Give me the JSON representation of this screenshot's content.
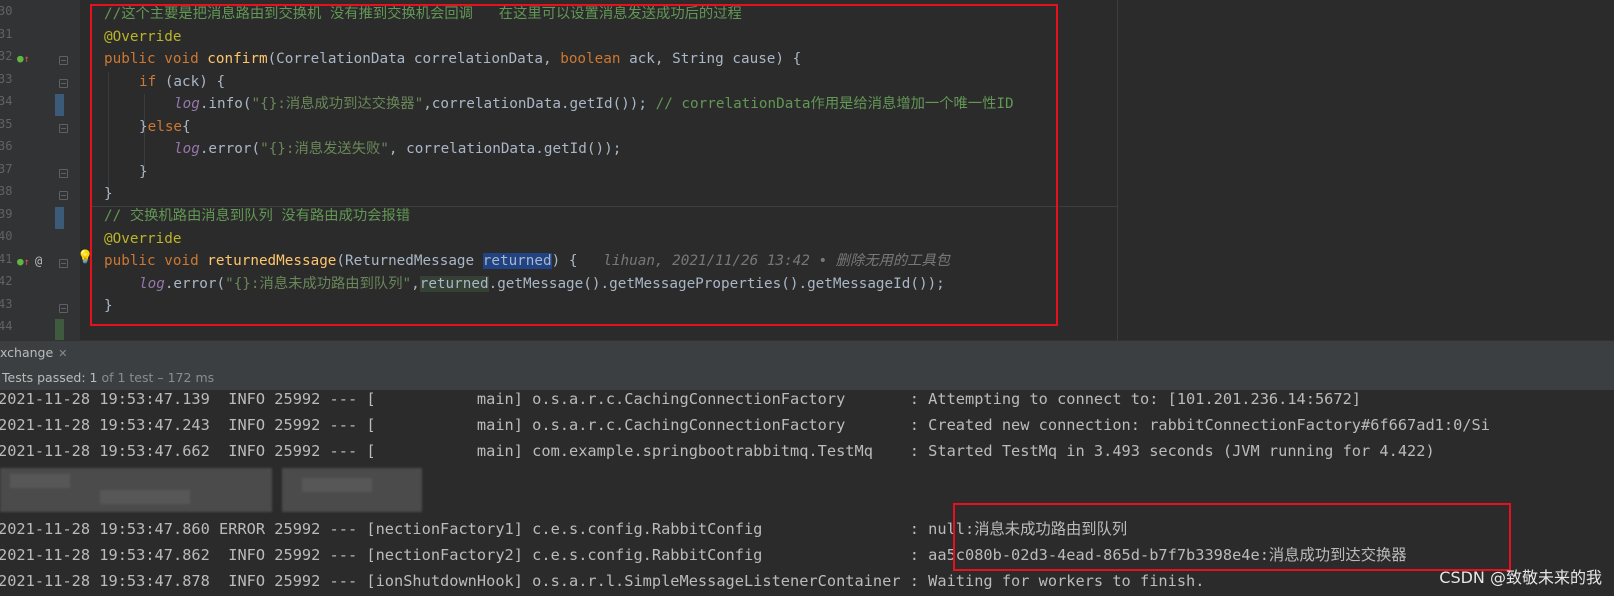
{
  "editor": {
    "line_numbers": [
      "30",
      "31",
      "32",
      "33",
      "34",
      "35",
      "36",
      "37",
      "38",
      "39",
      "40",
      "41",
      "42",
      "43",
      "44"
    ],
    "code": {
      "comment1": "//这个主要是把消息路由到交换机 没有推到交换机会回调   在这里可以设置消息发送成功后的过程",
      "annotation": "@Override",
      "confirm_kw": "public void ",
      "confirm_name": "confirm",
      "confirm_params_a": "(CorrelationData correlationData, ",
      "confirm_bool": "boolean",
      "confirm_params_b": " ack, String cause) {",
      "if_kw": "if",
      "if_rest": " (ack) {",
      "log": "log",
      "info_call": ".info(",
      "info_str": "\"{}:消息成功到达交换器\"",
      "info_rest": ",correlationData.getId()); ",
      "info_comment": "// correlationData作用是给消息增加一个唯一性ID",
      "else_a": "}",
      "else_kw": "else",
      "else_b": "{",
      "error_call": ".error(",
      "error_str": "\"{}:消息发送失败\"",
      "error_rest": ", correlationData.getId());",
      "brace": "}",
      "comment2": "// 交换机路由消息到队列 没有路由成功会报错",
      "returned_kw": "public void ",
      "returned_name": "returnedMessage",
      "returned_params_a": "(ReturnedMessage ",
      "returned_param": "returned",
      "returned_params_b": ") {",
      "blame": "lihuan, 2021/11/26 13:42 • 删除无用的工具包",
      "error2_str": "\"{}:消息未成功路由到队列\"",
      "error2_comma": ",",
      "error2_var": "returned",
      "error2_rest": ".getMessage().getMessageProperties().getMessageId());"
    }
  },
  "run_panel": {
    "tab_label": "xchange",
    "tests_label": "Tests passed: ",
    "tests_count": "1",
    "tests_rest": " of 1 test – 172 ms"
  },
  "console": {
    "lines": [
      "2021-11-28 19:53:47.139  INFO 25992 --- [           main] o.s.a.r.c.CachingConnectionFactory       : Attempting to connect to: [101.201.236.14:5672]",
      "2021-11-28 19:53:47.243  INFO 25992 --- [           main] o.s.a.r.c.CachingConnectionFactory       : Created new connection: rabbitConnectionFactory#6f667ad1:0/Si",
      "2021-11-28 19:53:47.662  INFO 25992 --- [           main] com.example.springbootrabbitmq.TestMq    : Started TestMq in 3.493 seconds (JVM running for 4.422)",
      "2021-11-28 19:53:47.860 ERROR 25992 --- [nectionFactory1] c.e.s.config.RabbitConfig                : null:消息未成功路由到队列",
      "2021-11-28 19:53:47.862  INFO 25992 --- [nectionFactory2] c.e.s.config.RabbitConfig                : aa5c080b-02d3-4ead-865d-b7f7b3398e4e:消息成功到达交换器",
      "2021-11-28 19:53:47.878  INFO 25992 --- [ionShutdownHook] o.s.a.r.l.SimpleMessageListenerContainer : Waiting for workers to finish."
    ]
  },
  "watermark": "CSDN @致敬未来的我",
  "colors": {
    "highlight_box": "#e8101f",
    "editor_bg": "#2b2b2b",
    "panel_bg": "#3c3f41"
  }
}
